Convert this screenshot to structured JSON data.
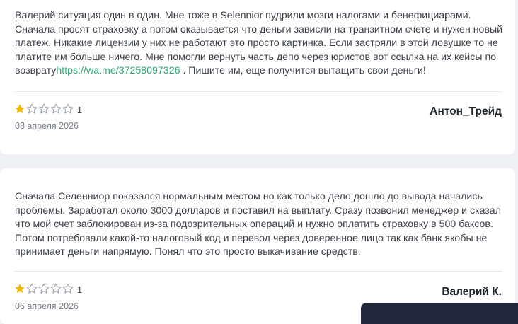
{
  "reviews": [
    {
      "text_before_link": "Валерий ситуация один в один. Мне тоже в Selennior пудрили мозги налогами и бенефициарами. Сначала просят страховку а потом оказывается что деньги зависли на транзитном счете и нужен новый платеж. Никакие лицензии у них не работают это просто картинка. Если застряли в этой ловушке то не платите им больше ничего. Мне помогли вернуть часть депо через юристов вот ссылка на их кейсы по возврату",
      "link": "https://wa.me/37258097326",
      "text_after_link": " . Пишите им, еще получится вытащить свои деньги!",
      "rating": 1,
      "rating_label": "1",
      "date": "08 апреля 2026",
      "author": "Антон_Трейд"
    },
    {
      "text": "Сначала Селенниор показался нормальным местом но как только дело дошло до вывода начались проблемы. Заработал около 3000 долларов и поставил на выплату. Сразу позвонил менеджер и сказал что мой счет заблокирован из-за подозрительных операций и нужно оплатить страховку в 500 баксов. Потом потребовали какой-то налоговый код и перевод через доверенное лицо так как банк якобы не принимает деньги напрямую. Понял что это просто выкачивание средств.",
      "rating": 1,
      "rating_label": "1",
      "date": "06 апреля 2026",
      "author": "Валерий К."
    }
  ],
  "colors": {
    "star_filled": "#f2b705",
    "star_empty_stroke": "#9aa0a8",
    "link": "#2fa874",
    "page_background": "#eef0f3"
  },
  "icons": {
    "star": "star-icon"
  }
}
